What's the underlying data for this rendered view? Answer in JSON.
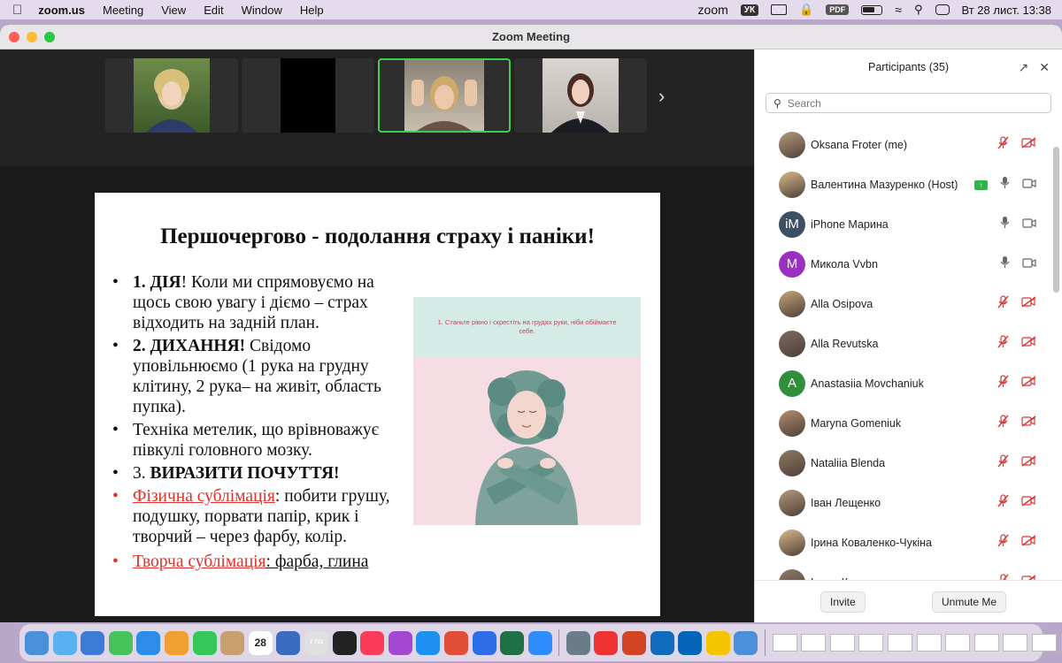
{
  "menubar": {
    "app_name": "zoom.us",
    "items": [
      "Meeting",
      "View",
      "Edit",
      "Window",
      "Help"
    ],
    "zoom_label": "zoom",
    "lang_badge": "УК",
    "pdf_badge": "PDF",
    "clock": "Вт 28 лист.  13:38"
  },
  "window": {
    "title": "Zoom Meeting"
  },
  "video_strip": {
    "next_icon": "chevron-right-icon"
  },
  "slide": {
    "title": "Першочергово - подолання страху і паніки!",
    "b1_bold": "1. ДІЯ",
    "b1_text": "! Коли ми спрямовуємо на щось свою увагу і діємо – страх відходить на задній  план.",
    "b2_bold": "2. ДИХАННЯ!",
    "b2_text": " Свідомо уповільнюємо (1 рука на грудну клітину, 2 рука– на живіт, область пупка).",
    "b3_text": "Техніка метелик, що врівноважує півкулі головного мозку.",
    "b4_prefix": "3. ",
    "b4_bold": "ВИРАЗИТИ ПОЧУТТЯ!",
    "b5_link": "Фізична сублімація",
    "b5_text": ": побити грушу, подушку, порвати папір, крик і творчий – через фарбу, колір.",
    "b6_link": "Творча сублімація",
    "b6_text": ": фарба, глина",
    "image_caption": "1. Станьте рівно і скрестіть на грудях руки, ніби обіймаєте себе."
  },
  "participants": {
    "header": "Participants (35)",
    "search_placeholder": "Search",
    "list": [
      {
        "name": "Oksana Froter (me)",
        "avatar": "photo",
        "mic": "muted",
        "video": "off"
      },
      {
        "name": "Валентина Мазуренко (Host)",
        "avatar": "photo",
        "mic": "on",
        "video": "on",
        "sharing": true
      },
      {
        "name": "iPhone Марина",
        "avatar": "iM",
        "avatar_color": "#3d4f63",
        "mic": "on",
        "video": "on"
      },
      {
        "name": "Микола Vvbn",
        "avatar": "M",
        "avatar_color": "#9b2fbf",
        "mic": "on",
        "video": "on"
      },
      {
        "name": "Alla Osipova",
        "avatar": "photo",
        "mic": "muted",
        "video": "off"
      },
      {
        "name": "Alla Revutska",
        "avatar": "photo",
        "mic": "muted",
        "video": "off"
      },
      {
        "name": "Anastasiia Movchaniuk",
        "avatar": "A",
        "avatar_color": "#2f8f3a",
        "mic": "muted",
        "video": "off"
      },
      {
        "name": "Maryna Gomeniuk",
        "avatar": "photo",
        "mic": "muted",
        "video": "off"
      },
      {
        "name": "Nataliia Blenda",
        "avatar": "photo",
        "mic": "muted",
        "video": "off"
      },
      {
        "name": "Іван Лещенко",
        "avatar": "photo",
        "mic": "muted",
        "video": "off"
      },
      {
        "name": "Ірина Коваленко-Чукіна",
        "avatar": "photo",
        "mic": "muted",
        "video": "off"
      },
      {
        "name": "Ірина Коваленко",
        "avatar": "photo",
        "mic": "muted",
        "video": "off"
      }
    ],
    "invite_label": "Invite",
    "unmute_label": "Unmute Me"
  },
  "dock": {
    "calendar_day": "28",
    "mail_badge": "7 732",
    "colors": [
      "#4a90d9",
      "#5ab0f0",
      "#3d7bd8",
      "#46c35a",
      "#2d8ce8",
      "#f0a030",
      "#35c759",
      "#c8a070",
      "#e84c4c",
      "#3a6bbf",
      "#e0e0e0",
      "#222222",
      "#fa3c5a",
      "#a347d0",
      "#1f8ff0",
      "#e04e39",
      "#2d6ee8",
      "#1e7145",
      "#2d8cff",
      "#6a7c8a",
      "#e33",
      "#d14424",
      "#0f6cbd",
      "#0364b8",
      "#f5c400"
    ]
  }
}
